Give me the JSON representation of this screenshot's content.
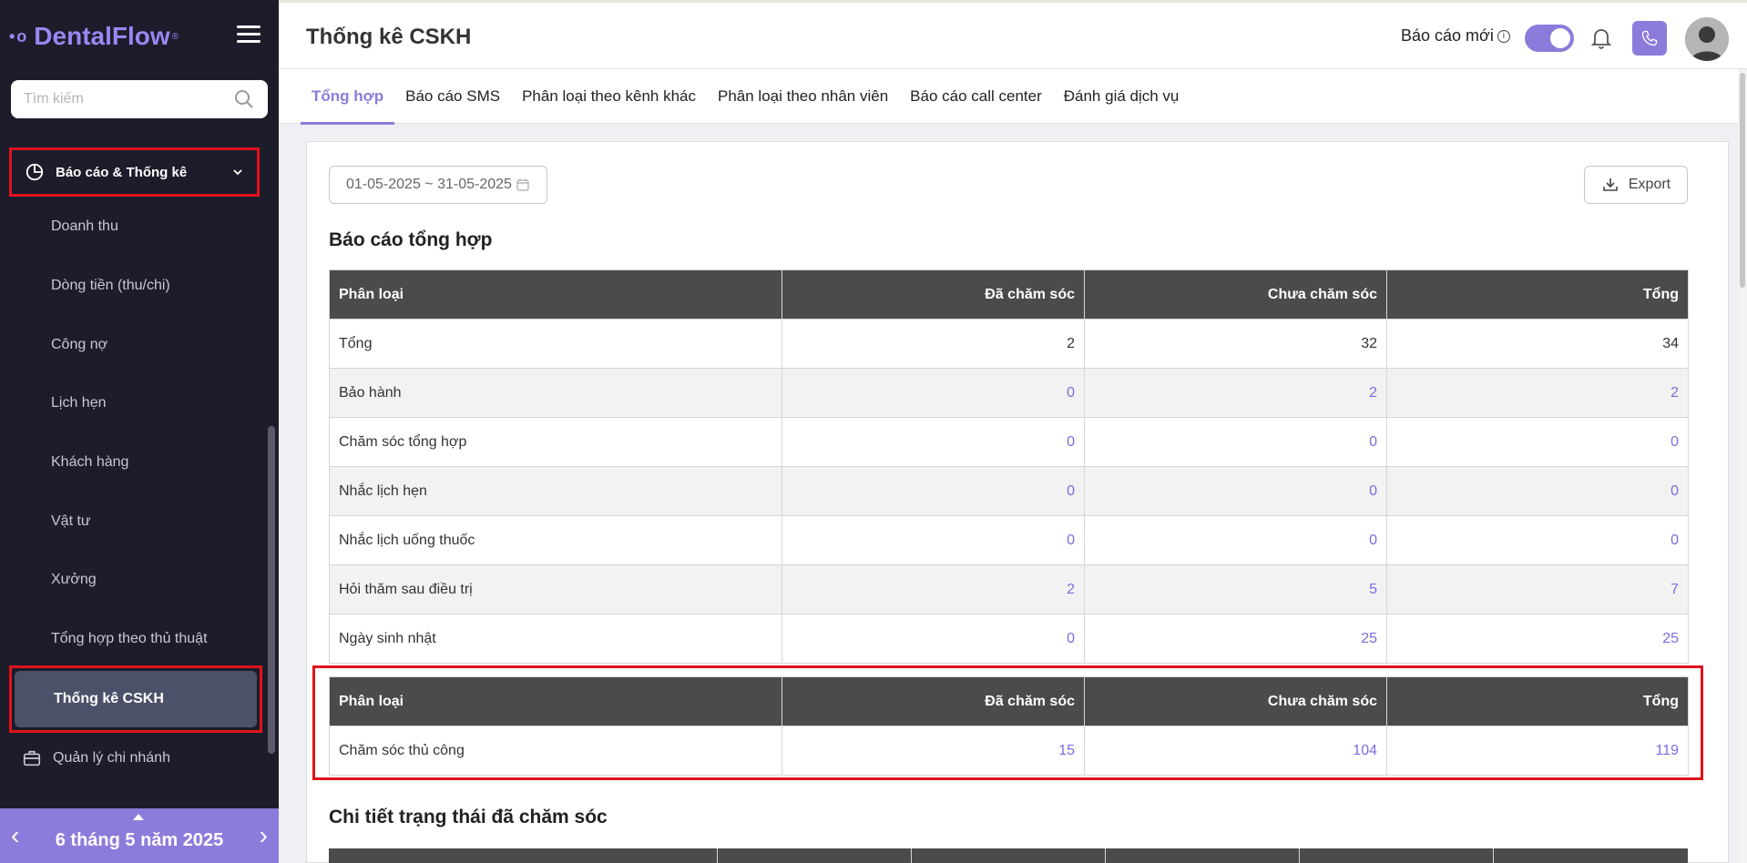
{
  "sidebar": {
    "logo_dots": "•o",
    "logo_text": "DentalFlow",
    "logo_reg": "®",
    "search_placeholder": "Tìm kiếm",
    "section_label": "Báo cáo & Thống kê",
    "items": [
      {
        "label": "Doanh thu"
      },
      {
        "label": "Dòng tiền (thu/chi)"
      },
      {
        "label": "Công nợ"
      },
      {
        "label": "Lịch hẹn"
      },
      {
        "label": "Khách hàng"
      },
      {
        "label": "Vật tư"
      },
      {
        "label": "Xưởng"
      },
      {
        "label": "Tổng hợp theo thủ thuật"
      }
    ],
    "active_item": "Thống kê CSKH",
    "branch_label": "Quản lý chi nhánh",
    "date_label": "6 tháng 5 năm 2025",
    "prev_arrow": "‹",
    "next_arrow": "›"
  },
  "header": {
    "title": "Thống kê CSKH",
    "report_new_label": "Báo cáo mới",
    "info_glyph": "i"
  },
  "tabs": [
    {
      "label": "Tổng hợp",
      "active": true
    },
    {
      "label": "Báo cáo SMS"
    },
    {
      "label": "Phân loại theo kênh khác"
    },
    {
      "label": "Phân loại theo nhân viên"
    },
    {
      "label": "Báo cáo call center"
    },
    {
      "label": "Đánh giá dịch vụ"
    }
  ],
  "filters": {
    "date_range": "01-05-2025 ~ 31-05-2025",
    "export_label": "Export"
  },
  "summary": {
    "title": "Báo cáo tổng hợp",
    "headers": [
      "Phân loại",
      "Đã chăm sóc",
      "Chưa chăm sóc",
      "Tổng"
    ],
    "rows": [
      {
        "label": "Tổng",
        "done": "2",
        "pending": "32",
        "total": "34"
      },
      {
        "label": "Bảo hành",
        "done": "0",
        "pending": "2",
        "total": "2"
      },
      {
        "label": "Chăm sóc tổng hợp",
        "done": "0",
        "pending": "0",
        "total": "0"
      },
      {
        "label": "Nhắc lịch hẹn",
        "done": "0",
        "pending": "0",
        "total": "0"
      },
      {
        "label": "Nhắc lịch uống thuốc",
        "done": "0",
        "pending": "0",
        "total": "0"
      },
      {
        "label": "Hỏi thăm sau điều trị",
        "done": "2",
        "pending": "5",
        "total": "7"
      },
      {
        "label": "Ngày sinh nhật",
        "done": "0",
        "pending": "25",
        "total": "25"
      }
    ]
  },
  "manual": {
    "headers": [
      "Phân loại",
      "Đã chăm sóc",
      "Chưa chăm sóc",
      "Tổng"
    ],
    "rows": [
      {
        "label": "Chăm sóc thủ công",
        "done": "15",
        "pending": "104",
        "total": "119"
      }
    ]
  },
  "detail": {
    "title": "Chi tiết trạng thái đã chăm sóc"
  },
  "colors": {
    "accent": "#8d7bdb",
    "sidebar_bg": "#1d1c2b",
    "table_header": "#4b4b4b",
    "highlight": "#e1131c",
    "link": "#7b6be0"
  }
}
